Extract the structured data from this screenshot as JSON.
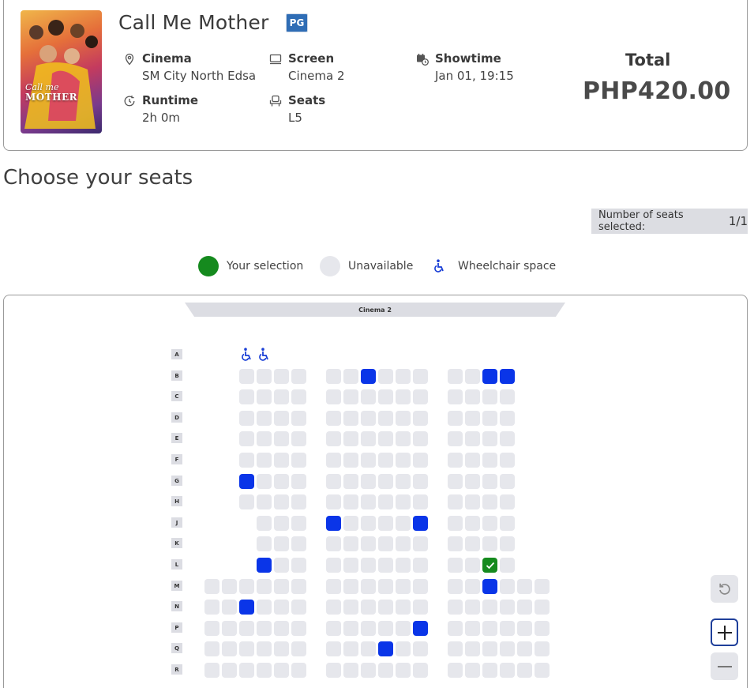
{
  "movie": {
    "title": "Call Me Mother",
    "rating": "PG",
    "poster_title_line1": "Call me",
    "poster_title_line2": "MOTHER"
  },
  "details": {
    "cinema_label": "Cinema",
    "cinema_value": "SM City North Edsa",
    "screen_label": "Screen",
    "screen_value": "Cinema 2",
    "showtime_label": "Showtime",
    "showtime_value": "Jan 01, 19:15",
    "runtime_label": "Runtime",
    "runtime_value": "2h 0m",
    "seats_label": "Seats",
    "seats_value": "L5"
  },
  "total": {
    "label": "Total",
    "value": "PHP420.00"
  },
  "section_title": "Choose your seats",
  "seat_counter": {
    "label": "Number of seats selected:",
    "value": "1/1"
  },
  "legend": {
    "selection": "Your selection",
    "unavailable": "Unavailable",
    "wheelchair": "Wheelchair space"
  },
  "colors": {
    "selected": "#158a1e",
    "taken": "#0a35e8",
    "available": "#e6e7ec",
    "wheelchair": "#1a3fd6"
  },
  "screen_name": "Cinema 2",
  "seat_map": {
    "rows": [
      "A",
      "B",
      "C",
      "D",
      "E",
      "F",
      "G",
      "H",
      "J",
      "K",
      "L",
      "M",
      "N",
      "P",
      "Q",
      "R"
    ],
    "wheelchair": [
      {
        "row": "A",
        "col": 3
      },
      {
        "row": "A",
        "col": 4
      }
    ],
    "row_columns": {
      "A": [],
      "B": [
        3,
        4,
        5,
        6,
        8,
        9,
        10,
        11,
        12,
        13,
        15,
        16,
        17,
        18
      ],
      "C": [
        3,
        4,
        5,
        6,
        8,
        9,
        10,
        11,
        12,
        13,
        15,
        16,
        17,
        18
      ],
      "D": [
        3,
        4,
        5,
        6,
        8,
        9,
        10,
        11,
        12,
        13,
        15,
        16,
        17,
        18
      ],
      "E": [
        3,
        4,
        5,
        6,
        8,
        9,
        10,
        11,
        12,
        13,
        15,
        16,
        17,
        18
      ],
      "F": [
        3,
        4,
        5,
        6,
        8,
        9,
        10,
        11,
        12,
        13,
        15,
        16,
        17,
        18
      ],
      "G": [
        3,
        4,
        5,
        6,
        8,
        9,
        10,
        11,
        12,
        13,
        15,
        16,
        17,
        18
      ],
      "H": [
        3,
        4,
        5,
        6,
        8,
        9,
        10,
        11,
        12,
        13,
        15,
        16,
        17,
        18
      ],
      "J": [
        4,
        5,
        6,
        8,
        9,
        10,
        11,
        12,
        13,
        15,
        16,
        17,
        18
      ],
      "K": [
        4,
        5,
        6,
        8,
        9,
        10,
        11,
        12,
        13,
        15,
        16,
        17,
        18
      ],
      "L": [
        4,
        5,
        6,
        8,
        9,
        10,
        11,
        12,
        13,
        15,
        16,
        17,
        18
      ],
      "M": [
        1,
        2,
        3,
        4,
        5,
        6,
        8,
        9,
        10,
        11,
        12,
        13,
        15,
        16,
        17,
        18,
        19,
        20
      ],
      "N": [
        1,
        2,
        3,
        4,
        5,
        6,
        8,
        9,
        10,
        11,
        12,
        13,
        15,
        16,
        17,
        18,
        19,
        20
      ],
      "P": [
        1,
        2,
        3,
        4,
        5,
        6,
        8,
        9,
        10,
        11,
        12,
        13,
        15,
        16,
        17,
        18,
        19,
        20
      ],
      "Q": [
        1,
        2,
        3,
        4,
        5,
        6,
        8,
        9,
        10,
        11,
        12,
        13,
        15,
        16,
        17,
        18,
        19,
        20
      ],
      "R": [
        1,
        2,
        3,
        4,
        5,
        6,
        8,
        9,
        10,
        11,
        12,
        13,
        15,
        16,
        17,
        18,
        19,
        20
      ]
    },
    "taken": [
      {
        "row": "B",
        "col": 10
      },
      {
        "row": "B",
        "col": 17
      },
      {
        "row": "B",
        "col": 18
      },
      {
        "row": "G",
        "col": 3
      },
      {
        "row": "J",
        "col": 8
      },
      {
        "row": "J",
        "col": 13
      },
      {
        "row": "L",
        "col": 4
      },
      {
        "row": "M",
        "col": 17
      },
      {
        "row": "N",
        "col": 3
      },
      {
        "row": "P",
        "col": 13
      },
      {
        "row": "Q",
        "col": 11
      }
    ],
    "selected": [
      {
        "row": "L",
        "col": 17
      }
    ]
  },
  "controls": {
    "reset": "reset-icon",
    "zoom_in": "plus-icon",
    "zoom_out": "minus-icon"
  }
}
